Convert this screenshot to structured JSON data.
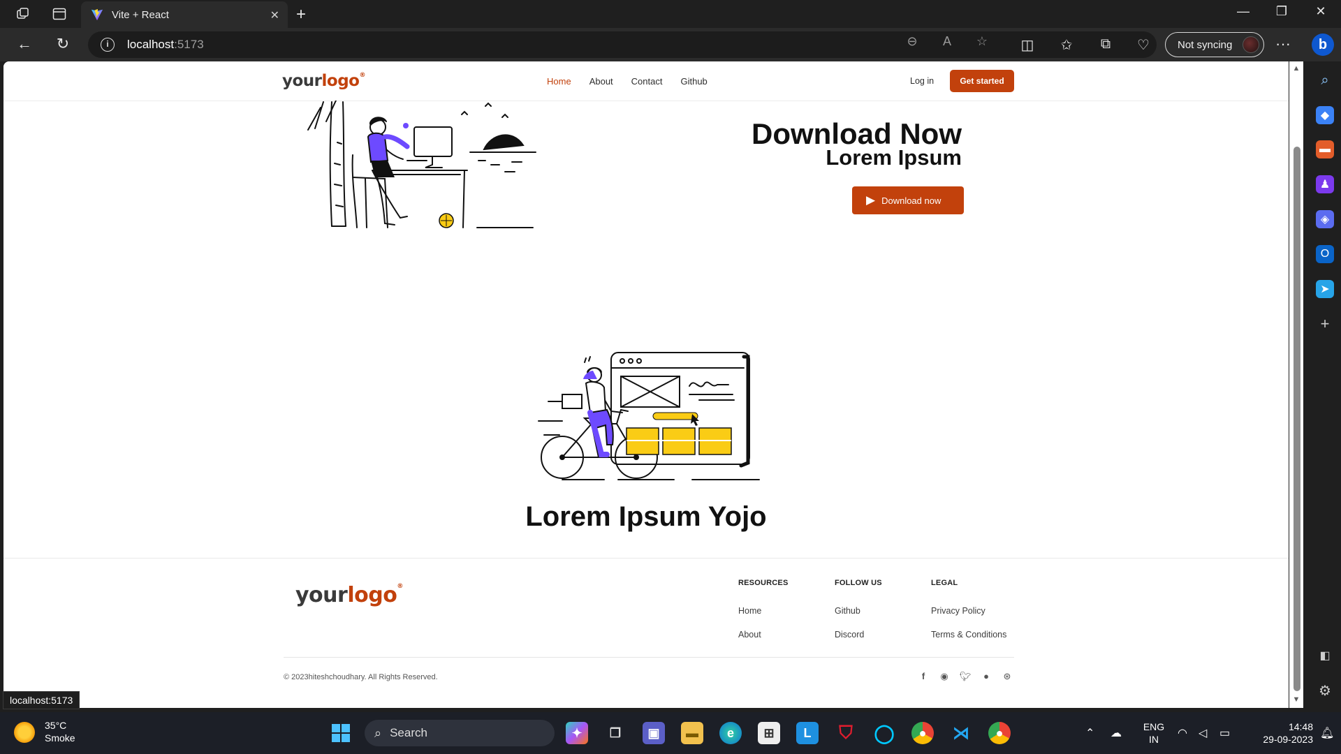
{
  "browser": {
    "tab_title": "Vite + React",
    "url_host": "localhost",
    "url_port": ":5173",
    "sync_label": "Not syncing",
    "status_tooltip": "localhost:5173"
  },
  "site": {
    "logo_part1": "your",
    "logo_part2": "logo",
    "logo_mark": "®",
    "nav": [
      {
        "label": "Home",
        "active": true
      },
      {
        "label": "About",
        "active": false
      },
      {
        "label": "Contact",
        "active": false
      },
      {
        "label": "Github",
        "active": false
      }
    ],
    "login_label": "Log in",
    "get_started_label": "Get started",
    "hero": {
      "title": "Download Now",
      "subtitle": "Lorem Ipsum",
      "button_label": "Download now"
    },
    "section2_title": "Lorem Ipsum Yojo",
    "footer": {
      "columns": [
        {
          "heading": "RESOURCES",
          "links": [
            "Home",
            "About"
          ]
        },
        {
          "heading": "FOLLOW US",
          "links": [
            "Github",
            "Discord"
          ]
        },
        {
          "heading": "LEGAL",
          "links": [
            "Privacy Policy",
            "Terms & Conditions"
          ]
        }
      ],
      "copyright": "© 2023hiteshchoudhary. All Rights Reserved.",
      "social_icons": [
        "facebook-icon",
        "discord-icon",
        "twitter-icon",
        "github-icon",
        "dribbble-icon"
      ]
    },
    "colors": {
      "accent": "#c2410c",
      "accent_illustration": "#6d4aff",
      "yellow_illustration": "#facc15"
    }
  },
  "taskbar": {
    "weather_temp": "35°C",
    "weather_desc": "Smoke",
    "search_placeholder": "Search",
    "lang_line1": "ENG",
    "lang_line2": "IN",
    "time": "14:48",
    "date": "29-09-2023"
  }
}
